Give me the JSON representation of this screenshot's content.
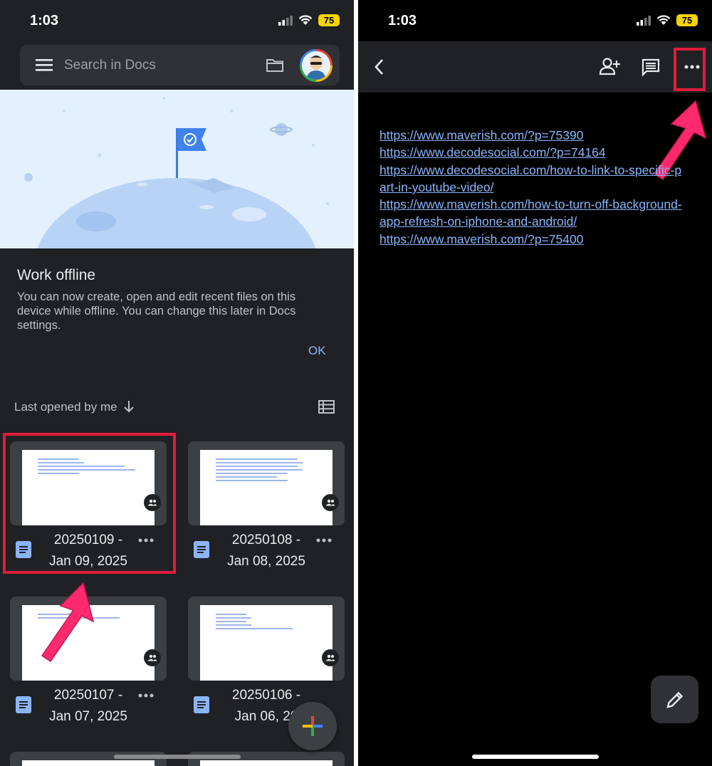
{
  "left": {
    "status": {
      "time": "1:03",
      "battery": "75"
    },
    "search": {
      "placeholder": "Search in Docs"
    },
    "offline": {
      "title": "Work offline",
      "body": "You can now create, open and edit recent files on this device while offline. You can change this later in Docs settings.",
      "ok": "OK"
    },
    "sort": {
      "label": "Last opened by me"
    },
    "docs": [
      {
        "title_line1": "20250109 -",
        "title_line2": "Jan 09, 2025"
      },
      {
        "title_line1": "20250108 -",
        "title_line2": "Jan 08, 2025"
      },
      {
        "title_line1": "20250107 -",
        "title_line2": "Jan 07, 2025"
      },
      {
        "title_line1": "20250106 -",
        "title_line2": "Jan 06, 20"
      }
    ]
  },
  "right": {
    "status": {
      "time": "1:03",
      "battery": "75"
    },
    "doc_lines": [
      "https://www.maverish.com/?p=75390",
      "https://www.decodesocial.com/?p=74164",
      "https://www.decodesocial.com/how-to-link-to-specific-p",
      "art-in-youtube-video/",
      "https://www.maverish.com/how-to-turn-off-background-",
      "app-refresh-on-iphone-and-android/",
      "https://www.maverish.com/?p=75400"
    ]
  },
  "colors": {
    "link": "#8ab4f8",
    "highlight": "#e01c3c",
    "docs_blue": "#8ab4f8",
    "battery": "#f5d400"
  }
}
